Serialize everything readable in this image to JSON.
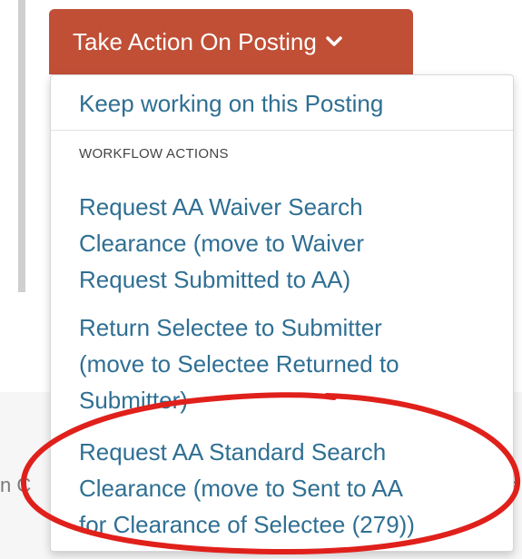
{
  "background": {
    "peek_left_char": "n C",
    "peek_right_char": "e"
  },
  "action_button": {
    "label": "Take Action On Posting",
    "color": "#c04f36",
    "icon": "chevron-down-icon"
  },
  "menu": {
    "keep_working": "Keep working on this Posting",
    "section_header": "WORKFLOW ACTIONS",
    "items": [
      {
        "lines": [
          "Request AA Waiver Search",
          "Clearance (move to Waiver",
          "Request Submitted to AA)"
        ]
      },
      {
        "lines": [
          "Return Selectee to Submitter",
          "(move to Selectee Returned to",
          "Submitter)"
        ]
      },
      {
        "lines": [
          "Request AA Standard Search",
          "Clearance (move to Sent to AA",
          "for Clearance of Selectee (279))"
        ]
      }
    ],
    "link_color": "#2f6f93"
  },
  "annotation": {
    "color": "#e0201b",
    "shape": "ellipse"
  }
}
